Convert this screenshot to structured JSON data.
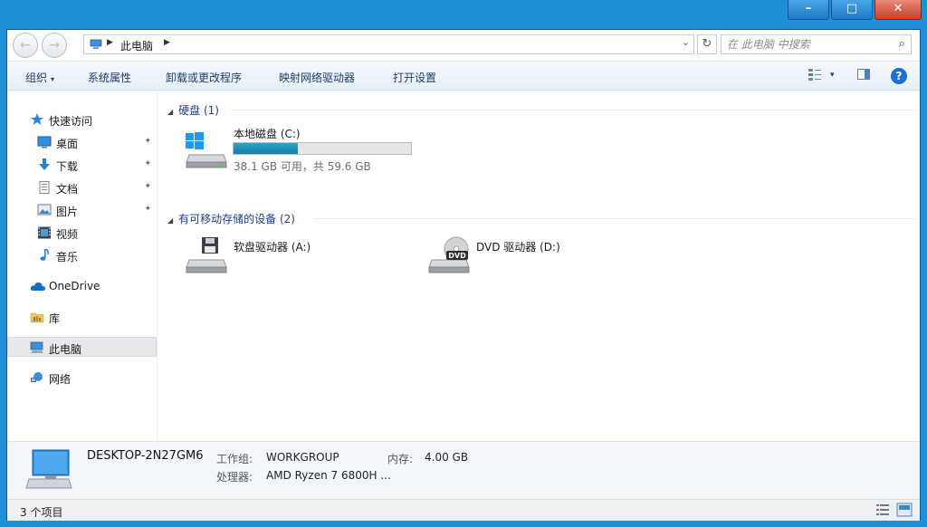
{
  "window": {
    "controls": {
      "minimize": "–",
      "maximize": "□",
      "close": "✕"
    }
  },
  "address": {
    "back_glyph": "←",
    "forward_glyph": "→",
    "crumb": "此电脑",
    "sep": "▶",
    "dropdown": "⌄",
    "refresh": "↻",
    "search_placeholder": "在 此电脑 中搜索",
    "search_glyph": "⌕"
  },
  "toolbar": {
    "organize": "组织",
    "organize_caret": "▾",
    "system_properties": "系统属性",
    "uninstall": "卸载或更改程序",
    "map_drive": "映射网络驱动器",
    "open_settings": "打开设置",
    "view_caret": "▾",
    "help": "?"
  },
  "sidebar": {
    "pin": "✦",
    "items": [
      {
        "label": "快速访问"
      },
      {
        "label": "桌面"
      },
      {
        "label": "下载"
      },
      {
        "label": "文档"
      },
      {
        "label": "图片"
      },
      {
        "label": "视频"
      },
      {
        "label": "音乐"
      },
      {
        "label": "OneDrive"
      },
      {
        "label": "库"
      },
      {
        "label": "此电脑"
      },
      {
        "label": "网络"
      }
    ]
  },
  "content": {
    "group_tri": "◢",
    "hard_disks_header": "硬盘 (1)",
    "removable_header": "有可移动存储的设备 (2)",
    "drives": [
      {
        "name": "本地磁盘 (C:)",
        "usage_text": "38.1 GB 可用，共 59.6 GB",
        "used_fraction": 0.36
      },
      {
        "name": "软盘驱动器 (A:)"
      },
      {
        "name": "DVD 驱动器 (D:)",
        "badge": "DVD"
      }
    ]
  },
  "details": {
    "computer_name": "DESKTOP-2N27GM6",
    "workgroup_label": "工作组:",
    "workgroup_value": "WORKGROUP",
    "memory_label": "内存:",
    "memory_value": "4.00 GB",
    "processor_label": "处理器:",
    "processor_value": "AMD Ryzen 7 6800H ..."
  },
  "status": {
    "item_count": "3 个项目"
  },
  "colors": {
    "titlebar": "#1f8fd8",
    "accent_text": "#1e3e8a",
    "drive_fill": "#1b7fa8"
  }
}
